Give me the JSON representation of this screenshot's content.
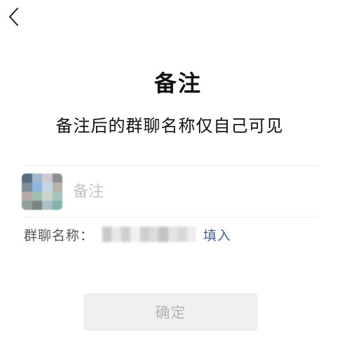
{
  "header": {
    "back_icon": "chevron-left-icon"
  },
  "main": {
    "title": "备注",
    "subtitle": "备注后的群聊名称仅自己可见"
  },
  "remark": {
    "avatar_colors": [
      "#5b6e7e",
      "#a3b9cf",
      "#cfc8d3",
      "#8a8f94",
      "#7d8d9c",
      "#8fb6e0",
      "#c4d7e8",
      "#b9b2a8",
      "#b9a8a8",
      "#9fbfb2",
      "#c7d6c8",
      "#a5c2bb",
      "#8f9f9a",
      "#7a8780",
      "#a9bfc9",
      "#7fb5a9"
    ],
    "placeholder": "备注"
  },
  "group": {
    "label": "群聊名称：",
    "name_blur_colors": [
      "#c9c9c9",
      "#e8e8e8",
      "#d0d0d0",
      "#f0f0f0",
      "#cfcfcf",
      "#dcdcdc",
      "#c4c4c4",
      "#e4e4e4",
      "#d8d8d8",
      "#ededed"
    ],
    "fill_label": "填入"
  },
  "actions": {
    "confirm_label": "确定"
  },
  "colors": {
    "link": "#4a5f8a",
    "button_bg": "#efefef",
    "button_text_disabled": "#b3b3b3",
    "placeholder": "#c4c4c4"
  }
}
